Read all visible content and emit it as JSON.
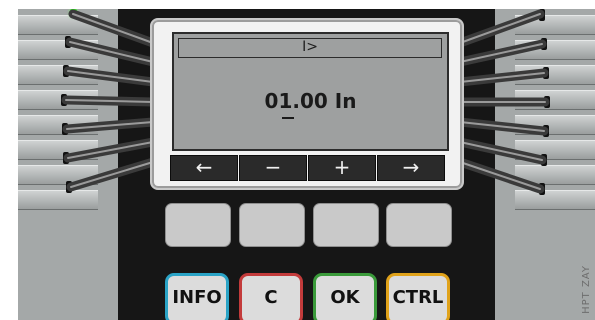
{
  "display": {
    "title": "I>",
    "value": "01.00 In"
  },
  "softkeys": [
    {
      "name": "left-arrow",
      "glyph": "←"
    },
    {
      "name": "minus",
      "glyph": "−"
    },
    {
      "name": "plus",
      "glyph": "+"
    },
    {
      "name": "right-arrow",
      "glyph": "→"
    }
  ],
  "keys": {
    "info": {
      "label": "INFO",
      "color": "#2aa3c6"
    },
    "c": {
      "label": "C",
      "color": "#c33b3b"
    },
    "ok": {
      "label": "OK",
      "color": "#3a9a3a"
    },
    "ctrl": {
      "label": "CTRL",
      "color": "#e0a21a"
    }
  },
  "maker_mark": "HPT ZAY",
  "status_led_color": "#39d12c"
}
